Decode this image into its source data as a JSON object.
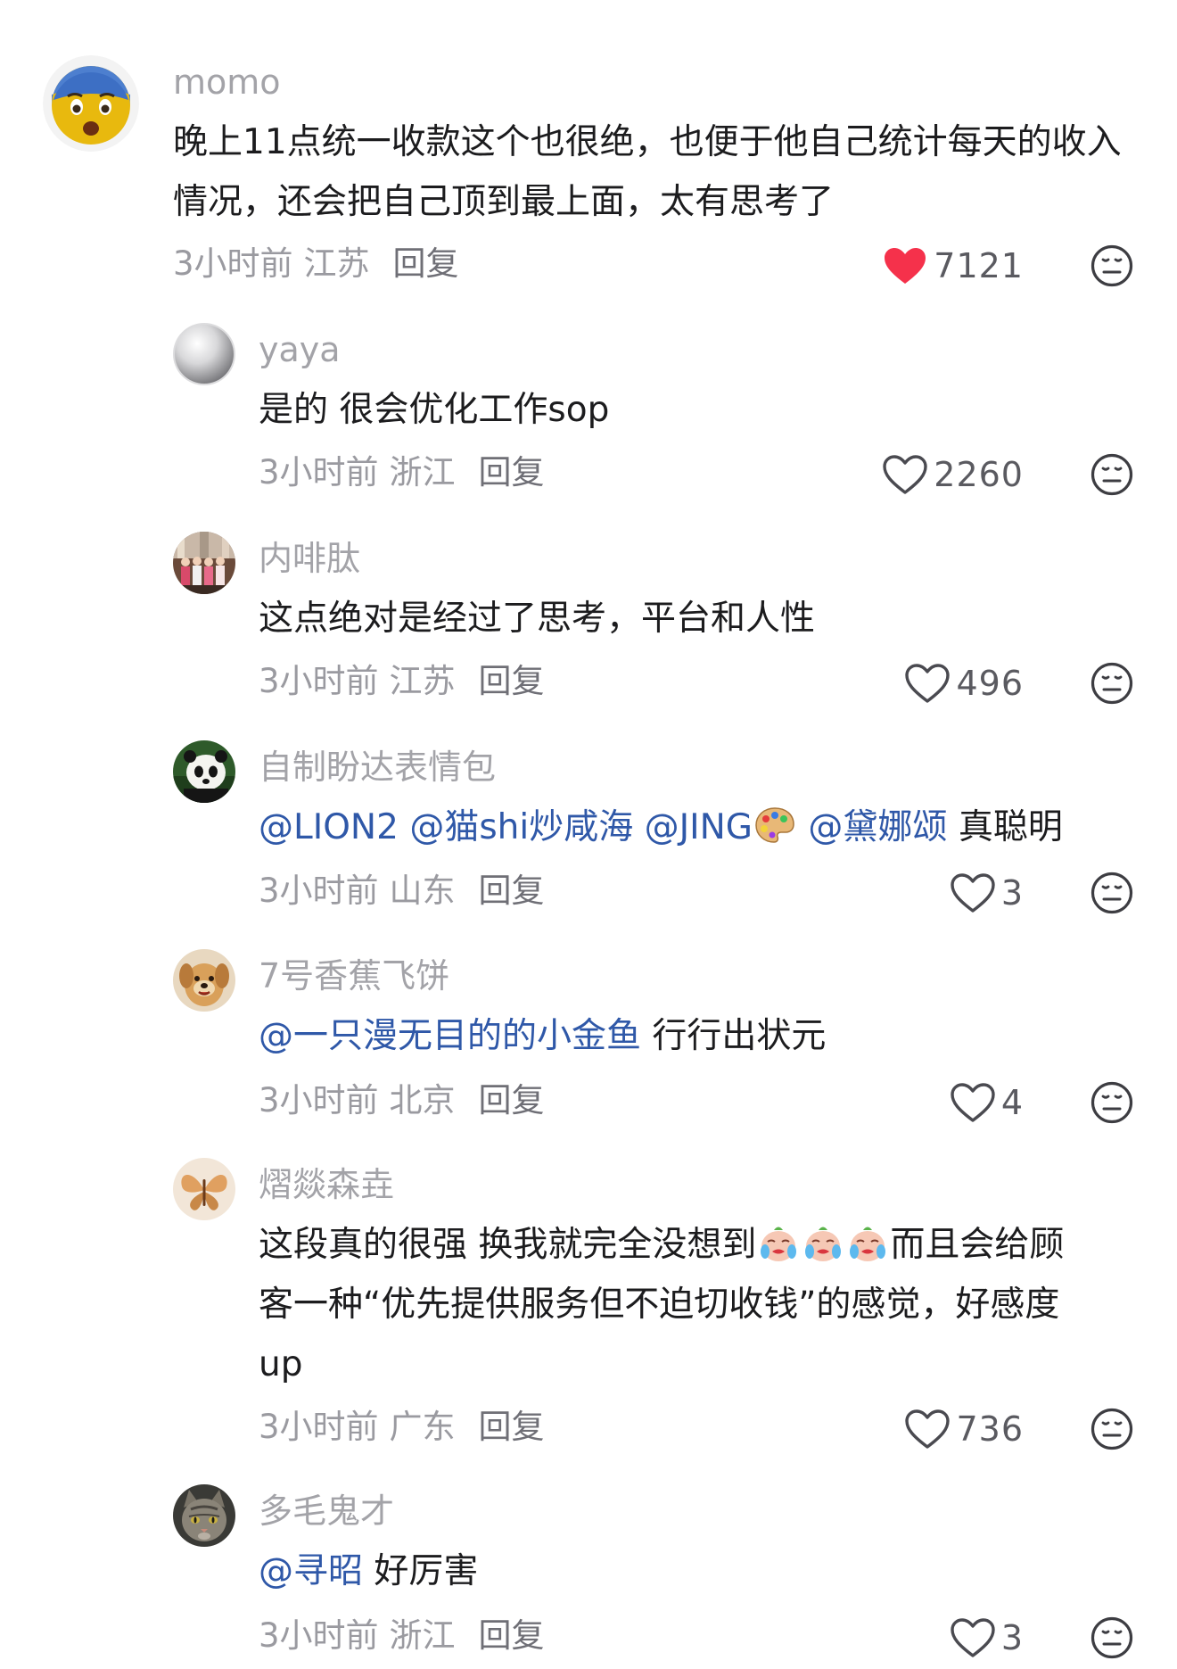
{
  "accent": {
    "heart_red": "#f5314b",
    "mention_blue": "#2f58a8"
  },
  "comments": [
    {
      "user": "momo",
      "avatar_icon": "fearful-face-emoji",
      "text": "晚上11点统一收款这个也很绝，也便于他自己统计每天的收入情况，还会把自己顶到最上面，太有思考了",
      "time": "3小时前",
      "location": "江苏",
      "reply": "回复",
      "likes": "7121",
      "liked": true
    },
    {
      "user": "yaya",
      "avatar_icon": "pearl-avatar",
      "text": "是的 很会优化工作sop",
      "time": "3小时前",
      "location": "浙江",
      "reply": "回复",
      "likes": "2260",
      "liked": false
    },
    {
      "user": "内啡肽",
      "avatar_icon": "group-photo-avatar",
      "text": "这点绝对是经过了思考，平台和人性",
      "time": "3小时前",
      "location": "江苏",
      "reply": "回复",
      "likes": "496",
      "liked": false
    },
    {
      "user": "自制盼达表情包",
      "avatar_icon": "panda-avatar",
      "mentions": [
        "@LION2",
        "@猫shi炒咸海",
        "@JING",
        "@黛娜颂"
      ],
      "text_after": "真聪明",
      "time": "3小时前",
      "location": "山东",
      "reply": "回复",
      "likes": "3",
      "liked": false
    },
    {
      "user": "7号香蕉飞饼",
      "avatar_icon": "toy-dog-avatar",
      "mentions": [
        "@一只漫无目的的小金鱼"
      ],
      "text_after": "行行出状元",
      "time": "3小时前",
      "location": "北京",
      "reply": "回复",
      "likes": "4",
      "liked": false
    },
    {
      "user": "熠燚森垚",
      "avatar_icon": "butterfly-avatar",
      "text_line1_a": "这段真的很强 换我就完全没想到",
      "text_line1_b": "而且会给顾",
      "text_line2": "客一种“优先提供服务但不迫切收钱”的感觉，好感度",
      "text_line3": "up",
      "time": "3小时前",
      "location": "广东",
      "reply": "回复",
      "likes": "736",
      "liked": false
    },
    {
      "user": "多毛鬼才",
      "avatar_icon": "cat-avatar",
      "mentions": [
        "@寻昭"
      ],
      "text_after": "好厉害",
      "time": "3小时前",
      "location": "浙江",
      "reply": "回复",
      "likes": "3",
      "liked": false
    }
  ]
}
